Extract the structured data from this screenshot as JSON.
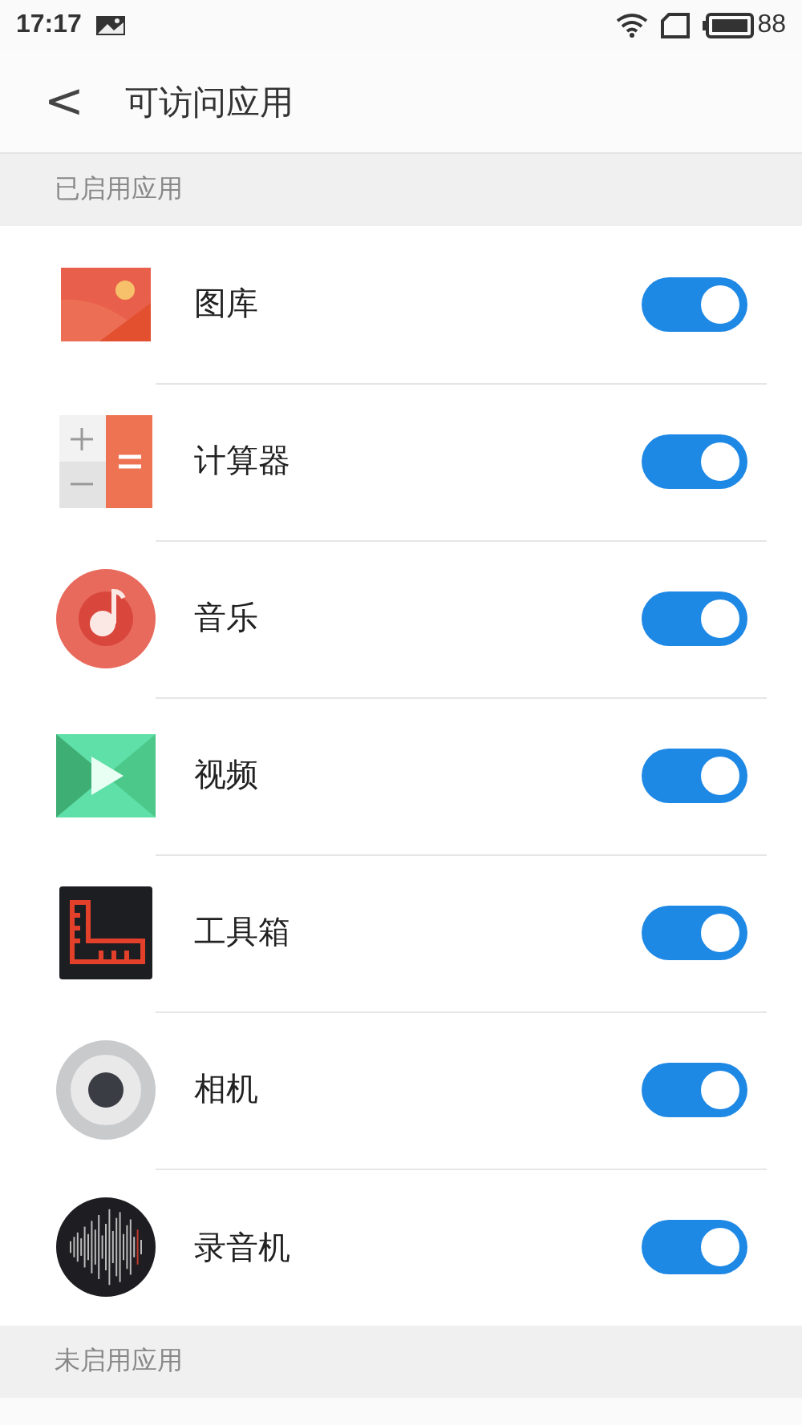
{
  "status_bar": {
    "time": "17:17",
    "battery": "88"
  },
  "header": {
    "back": "<",
    "title": "可访问应用"
  },
  "sections": [
    {
      "title": "已启用应用",
      "apps": [
        {
          "kind": "gallery",
          "name": "图库",
          "on": true
        },
        {
          "kind": "calculator",
          "name": "计算器",
          "on": true
        },
        {
          "kind": "music",
          "name": "音乐",
          "on": true
        },
        {
          "kind": "video",
          "name": "视频",
          "on": true
        },
        {
          "kind": "toolbox",
          "name": "工具箱",
          "on": true
        },
        {
          "kind": "camera",
          "name": "相机",
          "on": true
        },
        {
          "kind": "recorder",
          "name": "录音机",
          "on": true
        }
      ]
    },
    {
      "title": "未启用应用"
    }
  ]
}
